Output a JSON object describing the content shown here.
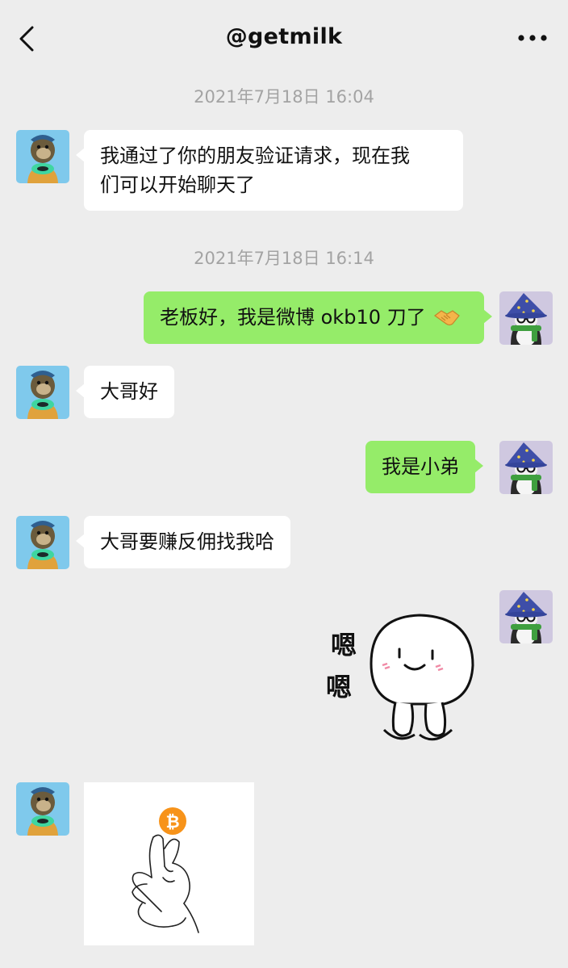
{
  "header": {
    "title": "@getmilk",
    "back_icon": "chevron-left-icon",
    "more_icon": "more-dots-icon"
  },
  "messages": [
    {
      "type": "timestamp",
      "text": "2021年7月18日 16:04"
    },
    {
      "type": "text",
      "side": "left",
      "sender": "other",
      "lines": [
        "我通过了你的朋友验证请求，现在我",
        "们可以开始聊天了"
      ]
    },
    {
      "type": "timestamp",
      "text": "2021年7月18日 16:14"
    },
    {
      "type": "text",
      "side": "right",
      "sender": "me",
      "text": "老板好，我是微博 okb10 刀了",
      "emoji": "handshake-icon"
    },
    {
      "type": "text",
      "side": "left",
      "sender": "other",
      "text": "大哥好"
    },
    {
      "type": "text",
      "side": "right",
      "sender": "me",
      "text": "我是小弟"
    },
    {
      "type": "text",
      "side": "left",
      "sender": "other",
      "text": "大哥要赚反佣找我哈"
    },
    {
      "type": "sticker",
      "side": "right",
      "sender": "me",
      "sticker_text": [
        "嗯",
        "嗯"
      ]
    },
    {
      "type": "image",
      "side": "left",
      "sender": "other",
      "image": "bitcoin-finger-heart",
      "coin_symbol": "₿"
    }
  ],
  "colors": {
    "background": "#ededed",
    "bubble_self": "#95ec69",
    "bubble_other": "#ffffff",
    "timestamp": "#a3a3a3",
    "bitcoin": "#f7931a"
  }
}
